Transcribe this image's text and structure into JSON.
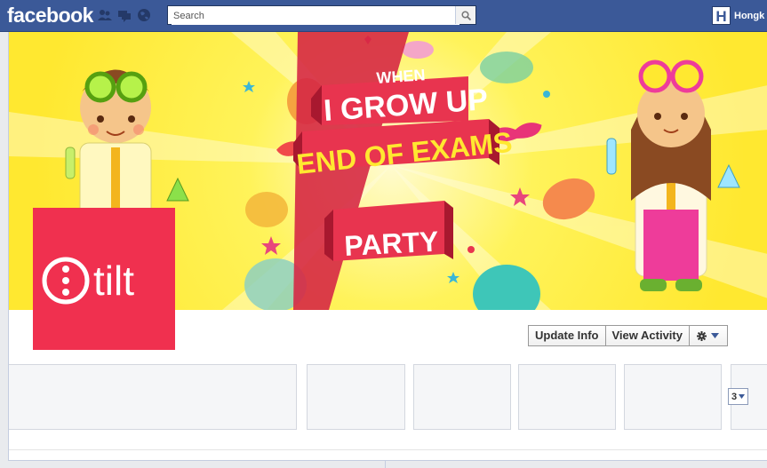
{
  "topbar": {
    "logo_text": "facebook",
    "search_placeholder": "Search",
    "user_initial": "H",
    "user_name": "Hongk"
  },
  "cover": {
    "banner_line1": "WHEN",
    "banner_line2": "I GROW UP",
    "banner_line3": "END OF EXAMS",
    "banner_line4": "PARTY"
  },
  "profile": {
    "logo_text": "tilt"
  },
  "actions": {
    "update_info": "Update Info",
    "view_activity": "View Activity"
  },
  "tiles": {
    "count": "3"
  },
  "colors": {
    "facebook_blue": "#3b5998",
    "banner_red": "#e8344f",
    "cover_yellow": "#ffe830",
    "profile_red": "#f0304f"
  }
}
